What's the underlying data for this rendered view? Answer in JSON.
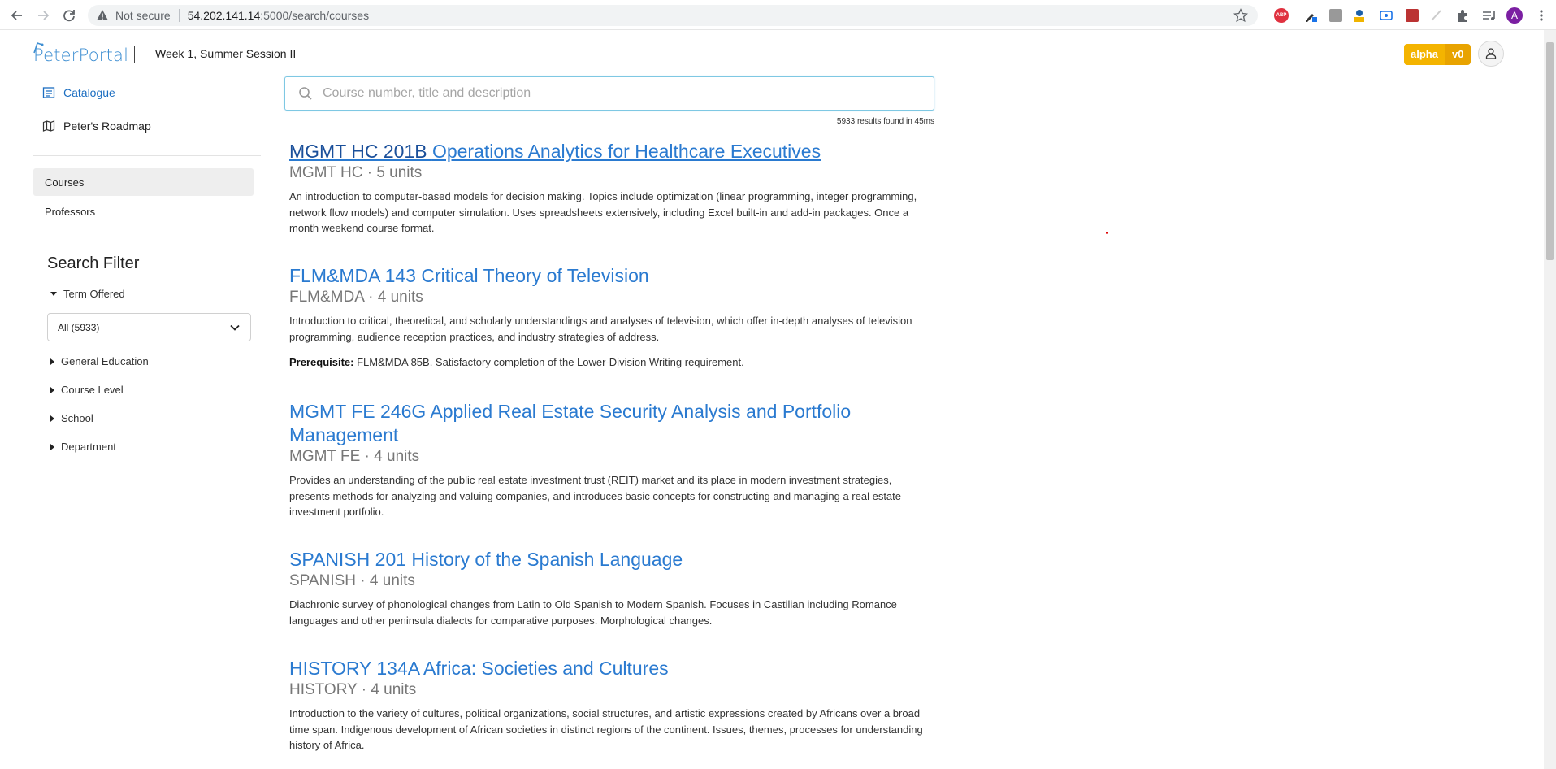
{
  "browser": {
    "not_secure": "Not secure",
    "url_host": "54.202.141.14",
    "url_path": ":5000/search/courses",
    "profile_initial": "A",
    "abp_label": "ABP"
  },
  "header": {
    "logo_text": "PeterPortal",
    "session": "Week 1, Summer Session II",
    "badge_alpha": "alpha",
    "badge_version": "v0"
  },
  "sidebar": {
    "catalogue": "Catalogue",
    "roadmap": "Peter's Roadmap",
    "courses": "Courses",
    "professors": "Professors",
    "filter_title": "Search Filter",
    "term_offered": "Term Offered",
    "term_value": "All (5933)",
    "groups": [
      "General Education",
      "Course Level",
      "School",
      "Department"
    ]
  },
  "search": {
    "placeholder": "Course number, title and description",
    "results_meta": "5933 results found in 45ms"
  },
  "courses": [
    {
      "code": "MGMT HC 201B",
      "title": "Operations Analytics for Healthcare Executives",
      "dept": "MGMT HC",
      "units": "5 units",
      "desc": "An introduction to computer-based models for decision making. Topics include optimization (linear programming, integer programming, network flow models) and computer simulation. Uses spreadsheets extensively, including Excel built-in and add-in packages. Once a month weekend course format."
    },
    {
      "code": "FLM&MDA 143",
      "title": "Critical Theory of Television",
      "dept": "FLM&MDA",
      "units": "4 units",
      "desc": "Introduction to critical, theoretical, and scholarly understandings and analyses of television, which offer in-depth analyses of television programming, audience reception practices, and industry strategies of address.",
      "prereq_label": "Prerequisite:",
      "prereq": "FLM&MDA 85B. Satisfactory completion of the Lower-Division Writing requirement."
    },
    {
      "code": "MGMT FE 246G",
      "title": "Applied Real Estate Security Analysis and Portfolio Management",
      "dept": "MGMT FE",
      "units": "4 units",
      "desc": "Provides an understanding of the public real estate investment trust (REIT) market and its place in modern investment strategies, presents methods for analyzing and valuing companies, and introduces basic concepts for constructing and managing a real estate investment portfolio."
    },
    {
      "code": "SPANISH 201",
      "title": "History of the Spanish Language",
      "dept": "SPANISH",
      "units": "4 units",
      "desc": "Diachronic survey of phonological changes from Latin to Old Spanish to Modern Spanish. Focuses in Castilian including Romance languages and other peninsula dialects for comparative purposes. Morphological changes."
    },
    {
      "code": "HISTORY 134A",
      "title": "Africa: Societies and Cultures",
      "dept": "HISTORY",
      "units": "4 units",
      "desc": "Introduction to the variety of cultures, political organizations, social structures, and artistic expressions created by Africans over a broad time span. Indigenous development of African societies in distinct regions of the continent. Issues, themes, processes for understanding history of Africa."
    }
  ]
}
